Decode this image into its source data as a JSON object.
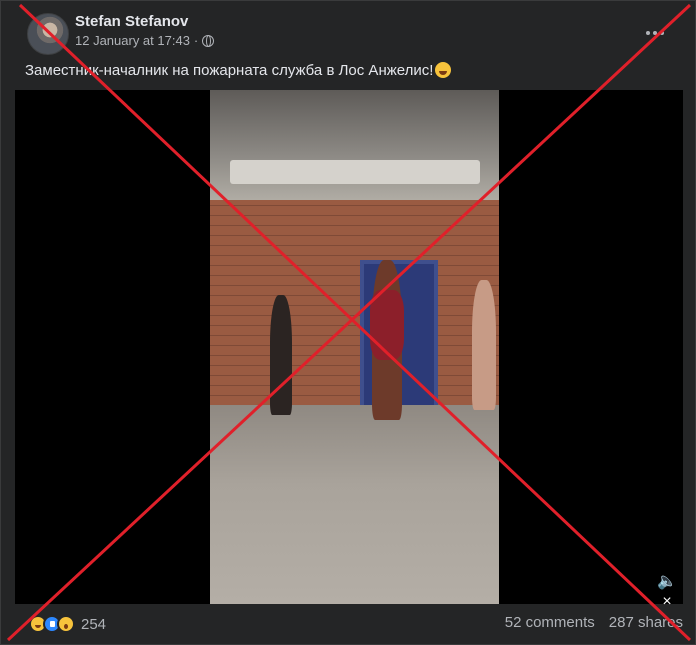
{
  "post": {
    "author": "Stefan Stefanov",
    "timestamp": "12 January at 17:43",
    "separator": "·",
    "caption": "Заместник-началник на пожарната служба в Лос Анжелис!"
  },
  "icons": {
    "privacy": "globe-icon",
    "more": "more-options-icon",
    "mute": "muted-speaker-icon",
    "reactions": [
      "haha-reaction-icon",
      "like-reaction-icon",
      "wow-reaction-icon"
    ]
  },
  "video": {
    "mute_symbol": "🔈×"
  },
  "engagement": {
    "reactions_count": "254",
    "comments": "52 comments",
    "shares": "287 shares"
  },
  "overlay": {
    "color": "#e0202a"
  }
}
